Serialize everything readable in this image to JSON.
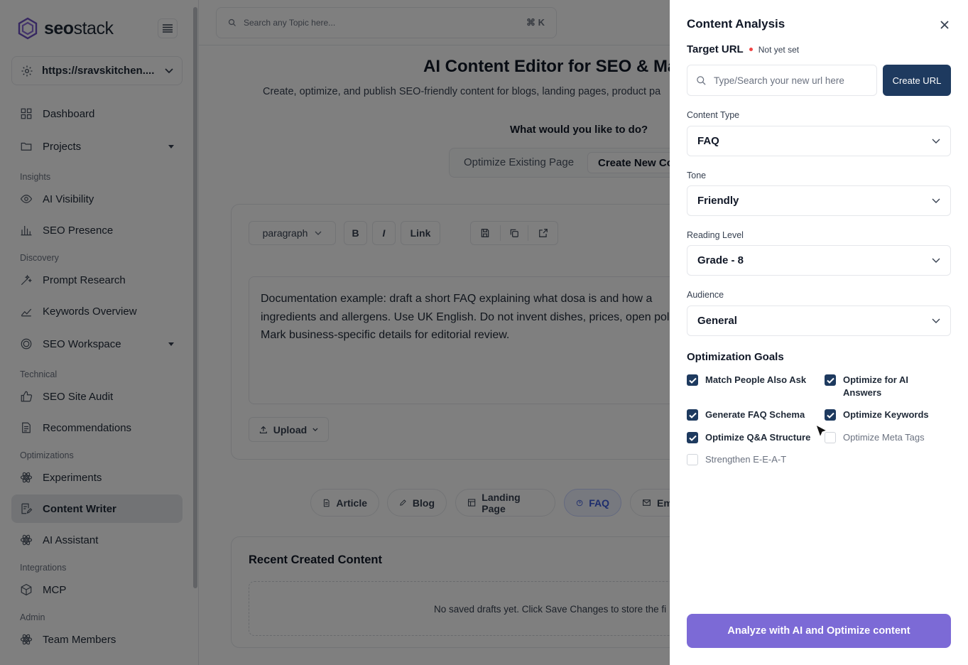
{
  "app": {
    "logo_text_bold": "seo",
    "logo_text": "stack"
  },
  "sidebar": {
    "site_url": "https://sravskitchen....",
    "items": [
      {
        "label": "Dashboard"
      },
      {
        "label": "Projects"
      },
      {
        "label": "AI Visibility"
      },
      {
        "label": "SEO Presence"
      },
      {
        "label": "Prompt Research"
      },
      {
        "label": "Keywords Overview"
      },
      {
        "label": "SEO Workspace"
      },
      {
        "label": "SEO Site Audit"
      },
      {
        "label": "Recommendations"
      },
      {
        "label": "Experiments"
      },
      {
        "label": "Content Writer"
      },
      {
        "label": "AI Assistant"
      },
      {
        "label": "MCP"
      },
      {
        "label": "Team Members"
      }
    ],
    "sections": [
      "Insights",
      "Discovery",
      "Technical",
      "Optimizations",
      "Integrations",
      "Admin"
    ]
  },
  "search": {
    "placeholder": "Search any Topic here...",
    "shortcut": "⌘ K"
  },
  "main": {
    "title": "AI Content Editor for SEO & Ma",
    "subtitle": "Create, optimize, and publish SEO-friendly content for blogs, landing pages, product pa",
    "question": "What would you like to do?",
    "modes": [
      "Optimize Existing Page",
      "Create New Co"
    ],
    "toolbar": {
      "format": "paragraph",
      "bold": "B",
      "italic": "I",
      "link": "Link"
    },
    "editor_text": "Documentation example: draft a short FAQ explaining what dosa is and how a ingredients and allergens. Use UK English. Do not invent dishes, prices, open policies. Mark business-specific details for editorial review.",
    "upload_label": "Upload",
    "content_types": [
      "Article",
      "Blog",
      "Landing Page",
      "FAQ",
      "Em"
    ],
    "recent_title": "Recent Created Content",
    "recent_empty": "No saved drafts yet. Click Save Changes to store the fi"
  },
  "panel": {
    "title": "Content Analysis",
    "target_url_label": "Target URL",
    "target_url_status": "Not yet set",
    "url_placeholder": "Type/Search your new url here",
    "create_url": "Create URL",
    "content_type_label": "Content Type",
    "content_type": "FAQ",
    "tone_label": "Tone",
    "tone": "Friendly",
    "reading_level_label": "Reading Level",
    "reading_level": "Grade - 8",
    "audience_label": "Audience",
    "audience": "General",
    "goals_title": "Optimization Goals",
    "goals": [
      {
        "label": "Match People Also Ask",
        "checked": true
      },
      {
        "label": "Optimize for AI Answers",
        "checked": true
      },
      {
        "label": "Generate FAQ Schema",
        "checked": true
      },
      {
        "label": "Optimize Keywords",
        "checked": true
      },
      {
        "label": "Optimize Q&A Structure",
        "checked": true
      },
      {
        "label": "Optimize Meta Tags",
        "checked": false
      },
      {
        "label": "Strengthen E-E-A-T",
        "checked": false
      }
    ],
    "analyze_button": "Analyze with AI and Optimize content"
  },
  "colors": {
    "accent": "#1e3a5f",
    "analyze": "#7c6ad6",
    "required_dot": "#ef4444"
  }
}
